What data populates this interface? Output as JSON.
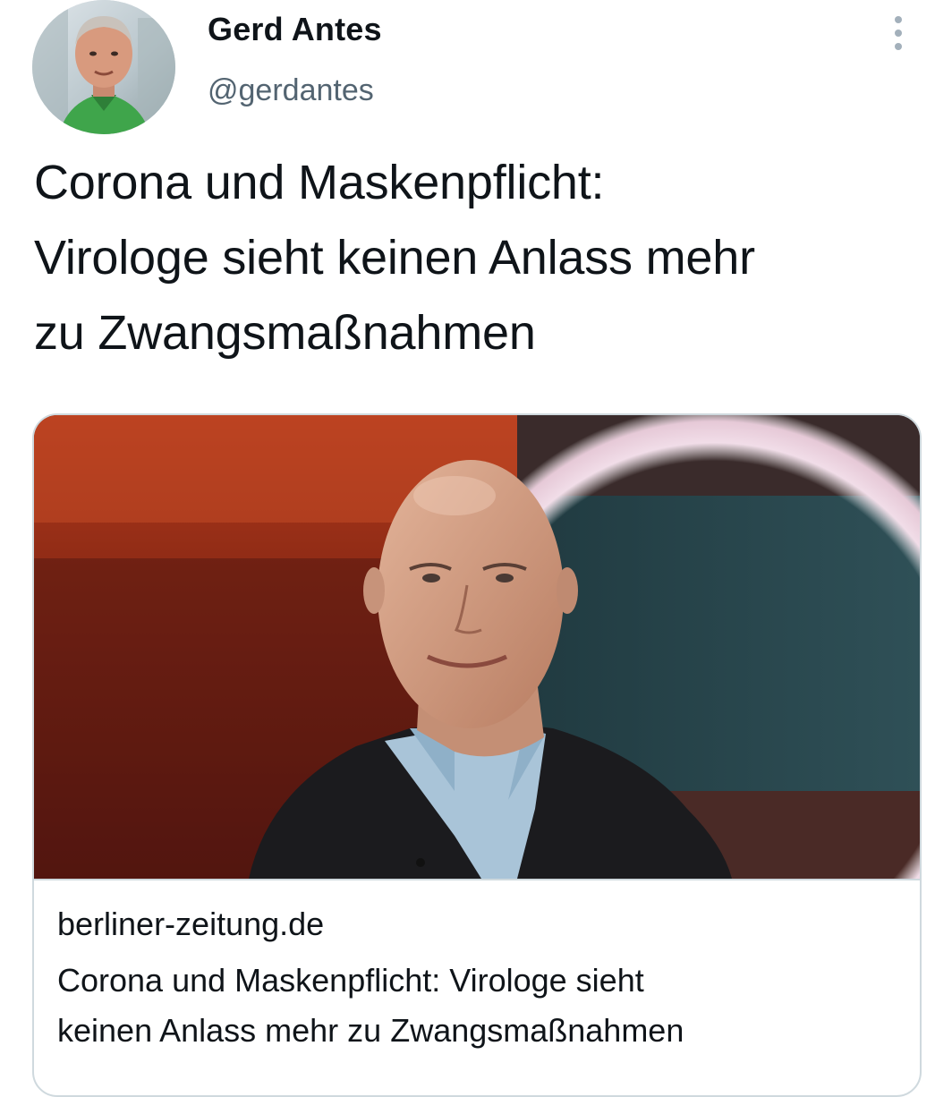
{
  "author": {
    "name": "Gerd Antes",
    "handle": "@gerdantes"
  },
  "tweet": {
    "text_lines": [
      "Corona und Maskenpflicht:",
      "Virologe sieht keinen Anlass mehr",
      "zu Zwangsmaßnahmen"
    ]
  },
  "link_card": {
    "domain": "berliner-zeitung.de",
    "title_lines": [
      "Corona und Maskenpflicht: Virologe sieht",
      "keinen Anlass mehr zu Zwangsmaßnahmen"
    ]
  },
  "icons": {
    "more": "more-vertical-icon"
  },
  "colors": {
    "text_primary": "#0f1419",
    "text_secondary": "#536471",
    "border": "#cfd9de",
    "icon_muted": "#a3b0bb"
  }
}
